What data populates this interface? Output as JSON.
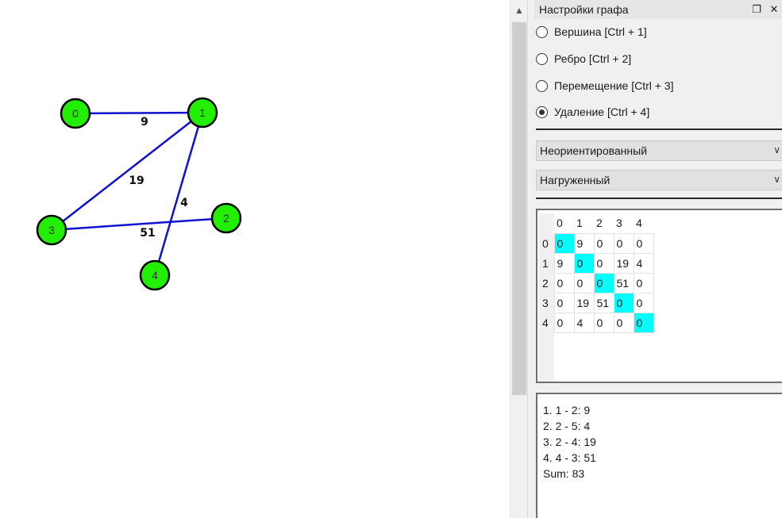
{
  "graph": {
    "vertices": [
      {
        "label": "0"
      },
      {
        "label": "1"
      },
      {
        "label": "2"
      },
      {
        "label": "3"
      },
      {
        "label": "4"
      }
    ],
    "edges": [
      {
        "from": 0,
        "to": 1,
        "weight": "9"
      },
      {
        "from": 1,
        "to": 3,
        "weight": "19"
      },
      {
        "from": 1,
        "to": 4,
        "weight": "4"
      },
      {
        "from": 3,
        "to": 2,
        "weight": "51"
      }
    ],
    "colors": {
      "vertex_fill": "#22ee00",
      "edge": "#1010d0"
    }
  },
  "panel": {
    "title": "Настройки графа",
    "restore_icon": "restore-window-icon",
    "close_icon": "close-icon",
    "modes": [
      {
        "label": "Вершина [Ctrl + 1]",
        "checked": false
      },
      {
        "label": "Ребро [Ctrl + 2]",
        "checked": false
      },
      {
        "label": "Перемещение [Ctrl + 3]",
        "checked": false
      },
      {
        "label": "Удаление [Ctrl + 4]",
        "checked": true
      }
    ],
    "direction_select": "Неориентированный",
    "weight_select": "Нагруженный"
  },
  "matrix": {
    "headers": [
      "0",
      "1",
      "2",
      "3",
      "4"
    ],
    "rows": [
      {
        "label": "0",
        "cells": [
          "0",
          "9",
          "0",
          "0",
          "0"
        ]
      },
      {
        "label": "1",
        "cells": [
          "9",
          "0",
          "0",
          "19",
          "4"
        ]
      },
      {
        "label": "2",
        "cells": [
          "0",
          "0",
          "0",
          "51",
          "0"
        ]
      },
      {
        "label": "3",
        "cells": [
          "0",
          "19",
          "51",
          "0",
          "0"
        ]
      },
      {
        "label": "4",
        "cells": [
          "0",
          "4",
          "0",
          "0",
          "0"
        ]
      }
    ],
    "diagonal_color": "#00ffff"
  },
  "result": {
    "lines": [
      "1. 1 - 2: 9",
      "2. 2 - 5: 4",
      "3. 2 - 4: 19",
      "4. 4 - 3: 51",
      "Sum: 83"
    ]
  }
}
